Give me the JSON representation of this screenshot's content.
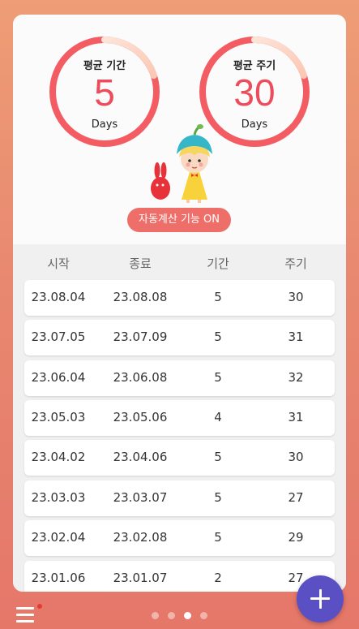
{
  "summary": {
    "avg_period": {
      "label": "평균 기간",
      "value": "5",
      "unit": "Days",
      "progress": 0.2
    },
    "avg_cycle": {
      "label": "평균 주기",
      "value": "30",
      "unit": "Days",
      "progress": 0.2
    }
  },
  "auto_calc": {
    "label": "자동계산 기능 ON"
  },
  "table": {
    "headers": [
      "시작",
      "종료",
      "기간",
      "주기"
    ],
    "rows": [
      [
        "23.08.04",
        "23.08.08",
        "5",
        "30"
      ],
      [
        "23.07.05",
        "23.07.09",
        "5",
        "31"
      ],
      [
        "23.06.04",
        "23.06.08",
        "5",
        "32"
      ],
      [
        "23.05.03",
        "23.05.06",
        "4",
        "31"
      ],
      [
        "23.04.02",
        "23.04.06",
        "5",
        "30"
      ],
      [
        "23.03.03",
        "23.03.07",
        "5",
        "27"
      ],
      [
        "23.02.04",
        "23.02.08",
        "5",
        "29"
      ],
      [
        "23.01.06",
        "23.01.07",
        "2",
        "27"
      ]
    ]
  },
  "pager": {
    "count": 4,
    "active": 2
  },
  "colors": {
    "accent": "#ee6e69",
    "ring": "#f45c64",
    "fab": "#5b4fc4"
  },
  "icons": {
    "menu": "menu-icon",
    "fab": "plus-icon"
  }
}
